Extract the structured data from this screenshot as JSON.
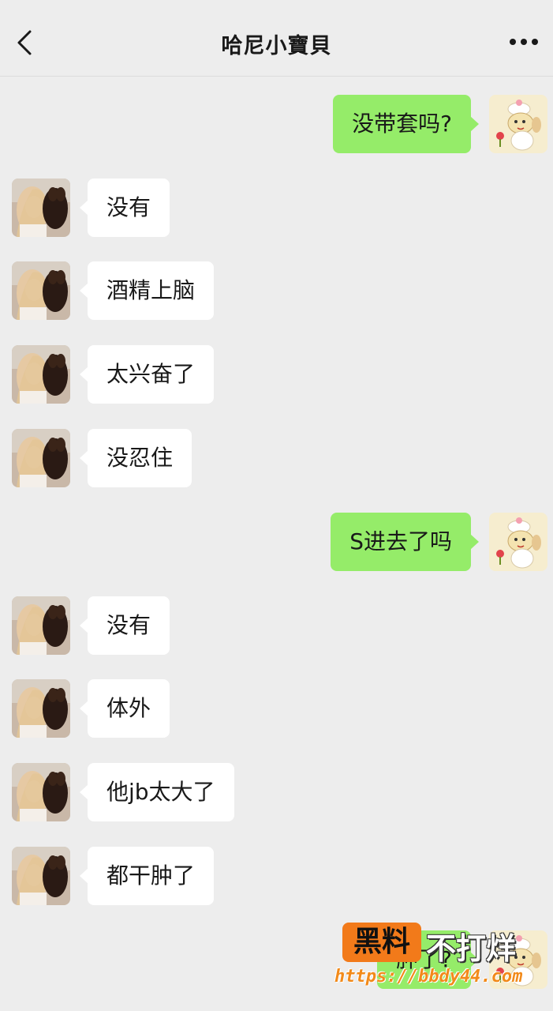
{
  "header": {
    "title": "哈尼小寶貝",
    "back_icon": "chevron-left-icon",
    "more_icon": "more-horizontal-icon"
  },
  "colors": {
    "background": "#ededed",
    "outgoing_bubble": "#95ec69",
    "incoming_bubble": "#ffffff",
    "watermark_orange": "#f27a1a"
  },
  "messages": [
    {
      "direction": "out",
      "text": "没带套吗?"
    },
    {
      "direction": "in",
      "text": "没有"
    },
    {
      "direction": "in",
      "text": "酒精上脑"
    },
    {
      "direction": "in",
      "text": "太兴奋了"
    },
    {
      "direction": "in",
      "text": "没忍住"
    },
    {
      "direction": "out",
      "text": "S进去了吗"
    },
    {
      "direction": "in",
      "text": "没有"
    },
    {
      "direction": "in",
      "text": "体外"
    },
    {
      "direction": "in",
      "text": "他jb太大了"
    },
    {
      "direction": "in",
      "text": "都干肿了"
    },
    {
      "direction": "out",
      "text": "肿了?"
    }
  ],
  "watermark": {
    "badge": "黑料",
    "text": "不打烊",
    "url": "https://bbdy44.com"
  }
}
